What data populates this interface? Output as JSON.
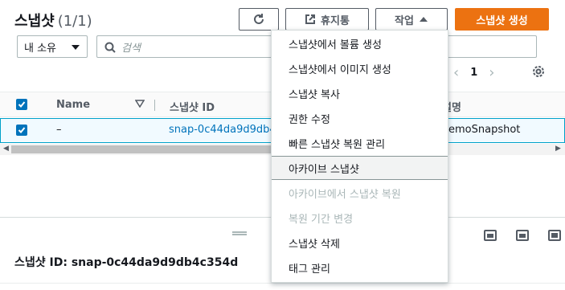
{
  "header": {
    "title": "스냅샷",
    "count": "(1/1)",
    "recycle_label": "휴지통",
    "actions_label": "작업",
    "create_label": "스냅샷 생성"
  },
  "filters": {
    "owner_value": "내 소유",
    "search_placeholder": "검색"
  },
  "pagination": {
    "current_page": "1"
  },
  "table": {
    "columns": [
      "Name",
      "스냅샷 ID",
      "설명"
    ],
    "rows": [
      {
        "name": "–",
        "snapshot_id": "snap-0c44da9d9db4",
        "description": "emoSnapshot"
      }
    ]
  },
  "detail": {
    "title": "스냅샷 ID: snap-0c44da9d9db4c354d"
  },
  "actions_menu": {
    "items": [
      {
        "label": "스냅샷에서 볼륨 생성",
        "state": "enabled"
      },
      {
        "label": "스냅샷에서 이미지 생성",
        "state": "enabled"
      },
      {
        "label": "스냅샷 복사",
        "state": "enabled"
      },
      {
        "label": "권한 수정",
        "state": "enabled"
      },
      {
        "label": "빠른 스냅샷 복원 관리",
        "state": "enabled"
      },
      {
        "label": "아카이브 스냅샷",
        "state": "highlighted"
      },
      {
        "label": "아카이브에서 스냅샷 복원",
        "state": "disabled"
      },
      {
        "label": "복원 기간 변경",
        "state": "disabled"
      },
      {
        "label": "스냅샷 삭제",
        "state": "enabled"
      },
      {
        "label": "태그 관리",
        "state": "enabled"
      }
    ]
  },
  "colors": {
    "primary_orange": "#ec7211",
    "link_blue": "#0073bb",
    "selected_row_bg": "#f1faff",
    "disabled_text": "#aab7b8"
  }
}
